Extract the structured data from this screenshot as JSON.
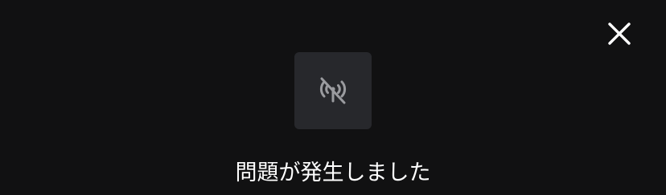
{
  "dialog": {
    "close_icon": "close-icon",
    "status_icon": "no-signal-icon",
    "message": "問題が発生しました"
  },
  "colors": {
    "background": "#111112",
    "icon_box": "#27282c",
    "icon": "#9a9b9f",
    "text": "#ffffff"
  }
}
